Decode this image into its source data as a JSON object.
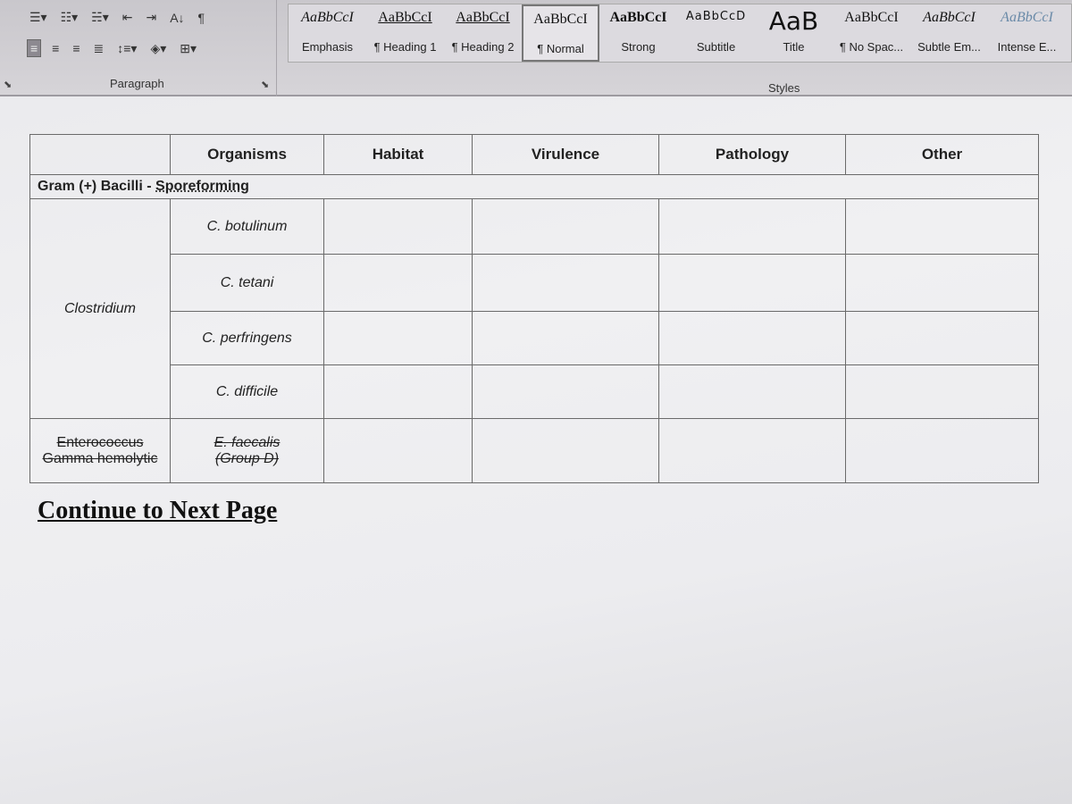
{
  "ribbon": {
    "paragraph_label": "Paragraph",
    "styles_label": "Styles",
    "paragraph_buttons_row1": [
      "bullets",
      "numbering",
      "multilevel-list",
      "decrease-indent",
      "increase-indent",
      "sort",
      "show-formatting"
    ],
    "paragraph_buttons_row2": [
      "align-left",
      "center",
      "align-right",
      "justify",
      "line-spacing",
      "shading",
      "borders"
    ],
    "styles": [
      {
        "preview": "AaBbCcI",
        "name": "Emphasis"
      },
      {
        "preview": "AaBbCcI",
        "name": "¶ Heading 1"
      },
      {
        "preview": "AaBbCcI",
        "name": "¶ Heading 2"
      },
      {
        "preview": "AaBbCcI",
        "name": "¶ Normal",
        "selected": true
      },
      {
        "preview": "AaBbCcI",
        "name": "Strong"
      },
      {
        "preview": "AaBbCcD",
        "name": "Subtitle"
      },
      {
        "preview": "AaB",
        "name": "Title"
      },
      {
        "preview": "AaBbCcI",
        "name": "¶ No Spac..."
      },
      {
        "preview": "AaBbCcI",
        "name": "Subtle Em..."
      },
      {
        "preview": "AaBbCcI",
        "name": "Intense E..."
      }
    ]
  },
  "table": {
    "headers": [
      "",
      "Organisms",
      "Habitat",
      "Virulence",
      "Pathology",
      "Other"
    ],
    "section": {
      "prefix": "Gram (+) Bacilli - ",
      "underlined": "Sporeforming"
    },
    "group": "Clostridium",
    "organisms": [
      "C. botulinum",
      "C. tetani",
      "C. perfringens",
      "C. difficile"
    ],
    "struck_row": {
      "genus_line1": "Enterococcus",
      "genus_line2": "Gamma hemolytic",
      "organism_line1": "E. faecalis",
      "organism_line2": "(Group D)"
    }
  },
  "footer_text": "Continue to Next Page"
}
